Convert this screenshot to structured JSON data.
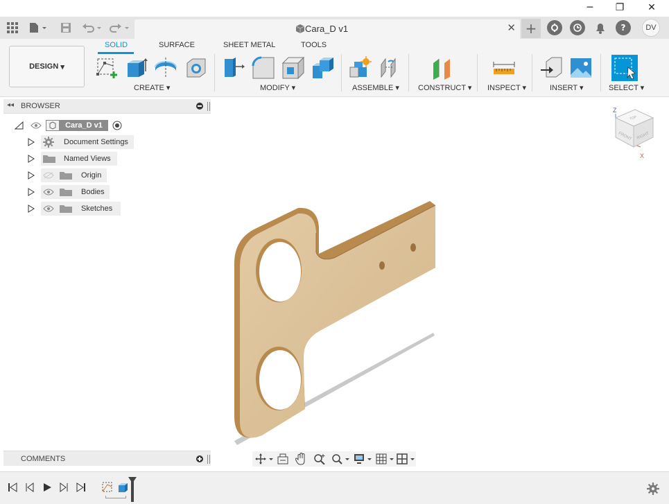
{
  "window": {
    "minimize": "─",
    "maximize": "❐",
    "close": "✕"
  },
  "app_bar": {
    "doc_title": "Cara_D v1",
    "doc_close": "✕",
    "new_tab": "+",
    "user_initials": "DV",
    "icons": [
      "apps-grid-icon",
      "file-icon",
      "save-icon",
      "undo-icon",
      "redo-icon",
      "new-tab-icon",
      "extensions-icon",
      "job-status-icon",
      "notifications-icon",
      "help-icon"
    ]
  },
  "toolbar": {
    "workspace": "DESIGN",
    "workspace_caret": "▾",
    "tabs": [
      "SOLID",
      "SURFACE",
      "SHEET METAL",
      "TOOLS"
    ],
    "active_tab": "SOLID",
    "groups": {
      "create": "CREATE",
      "modify": "MODIFY",
      "assemble": "ASSEMBLE",
      "construct": "CONSTRUCT",
      "inspect": "INSPECT",
      "insert": "INSERT",
      "select": "SELECT"
    },
    "caret": "▾"
  },
  "browser": {
    "title": "BROWSER",
    "root": "Cara_D v1",
    "items": [
      {
        "label": "Document Settings",
        "icon": "gear-icon"
      },
      {
        "label": "Named Views",
        "icon": "folder-icon"
      },
      {
        "label": "Origin",
        "icon": "folder-icon"
      },
      {
        "label": "Bodies",
        "icon": "folder-icon"
      },
      {
        "label": "Sketches",
        "icon": "folder-icon"
      }
    ]
  },
  "comments": {
    "title": "COMMENTS"
  },
  "viewcube": {
    "axis_z": "Z",
    "axis_x": "X",
    "faces": {
      "top": "TOP",
      "front": "FRONT",
      "right": "RIGHT"
    }
  },
  "colors": {
    "accent": "#0696d7",
    "part_face": "#dcc29a",
    "part_edge": "#b98a4e"
  }
}
